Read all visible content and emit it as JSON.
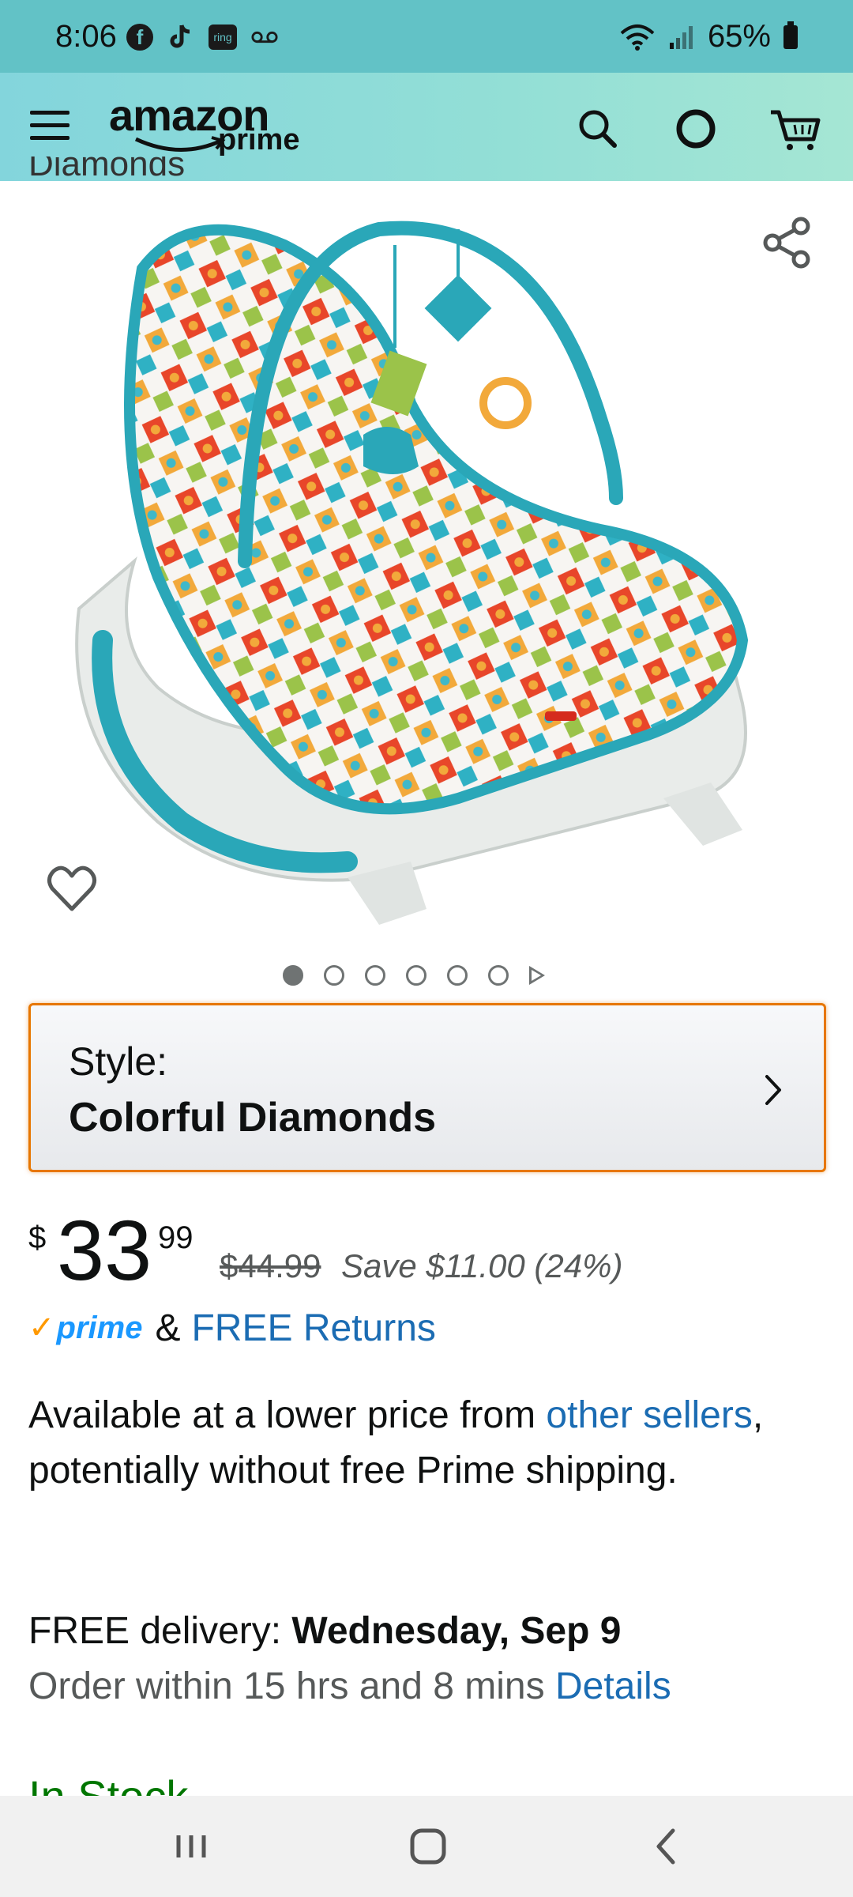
{
  "status_bar": {
    "time": "8:06",
    "ring_label": "ring",
    "battery": "65%"
  },
  "header": {
    "logo_main": "amazon",
    "logo_sub": "prime",
    "icons": [
      "menu-icon",
      "search-icon",
      "alexa-icon",
      "cart-icon"
    ]
  },
  "product": {
    "partial_title": "Diamonds",
    "image_alt": "Fisher-Price infant-to-toddler rocker in Colorful Diamonds print",
    "carousel_dot_count": 6,
    "carousel_active_index": 0
  },
  "style_selector": {
    "label": "Style:",
    "value": "Colorful Diamonds"
  },
  "price": {
    "symbol": "$",
    "whole": "33",
    "fraction": "99",
    "list_price": "$44.99",
    "savings": "Save $11.00 (24%)"
  },
  "prime": {
    "check": "✓",
    "word": "prime",
    "amp": "&",
    "free_returns": "FREE Returns"
  },
  "lower_price": {
    "text_before": "Available at a lower price from ",
    "link": "other sellers",
    "text_after": ", potentially without free Prime shipping."
  },
  "delivery": {
    "label": "FREE delivery: ",
    "date": "Wednesday, Sep 9",
    "order_within": "Order within 15 hrs and 8 mins ",
    "details_link": "Details"
  },
  "stock": {
    "text": "In Stock"
  },
  "colors": {
    "status_bar_bg": "#62c2c6",
    "header_bg": "#93dfd6",
    "style_border": "#e77600",
    "link": "#1b6cb3",
    "prime_blue": "#1a98ff",
    "prime_orange": "#ff9900",
    "in_stock": "#007600"
  }
}
